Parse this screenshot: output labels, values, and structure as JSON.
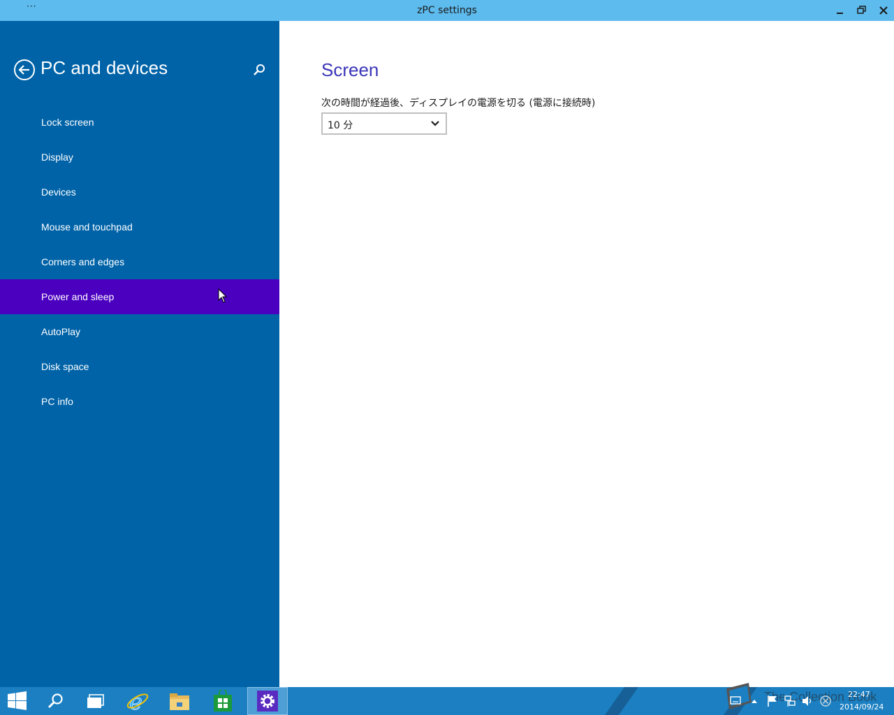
{
  "window": {
    "menu_glyph": "···",
    "title": "zPC settings"
  },
  "sidebar": {
    "title": "PC and devices",
    "items": [
      {
        "label": "Lock screen",
        "selected": false
      },
      {
        "label": "Display",
        "selected": false
      },
      {
        "label": "Devices",
        "selected": false
      },
      {
        "label": "Mouse and touchpad",
        "selected": false
      },
      {
        "label": "Corners and edges",
        "selected": false
      },
      {
        "label": "Power and sleep",
        "selected": true
      },
      {
        "label": "AutoPlay",
        "selected": false
      },
      {
        "label": "Disk space",
        "selected": false
      },
      {
        "label": "PC info",
        "selected": false
      }
    ]
  },
  "main": {
    "section_title": "Screen",
    "setting_label": "次の時間が経過後、ディスプレイの電源を切る (電源に接続時)",
    "dropdown_value": "10 分"
  },
  "taskbar": {
    "clock_time": "22:47",
    "clock_date": "2014/09/24",
    "watermark": "The Collection Book"
  },
  "colors": {
    "sidebar_bg": "#0063a8",
    "selected_bg": "#4b00c0",
    "titlebar_bg": "#5dbbee",
    "accent_title": "#3a35b8",
    "taskbar_bg": "#1b7fc2"
  }
}
